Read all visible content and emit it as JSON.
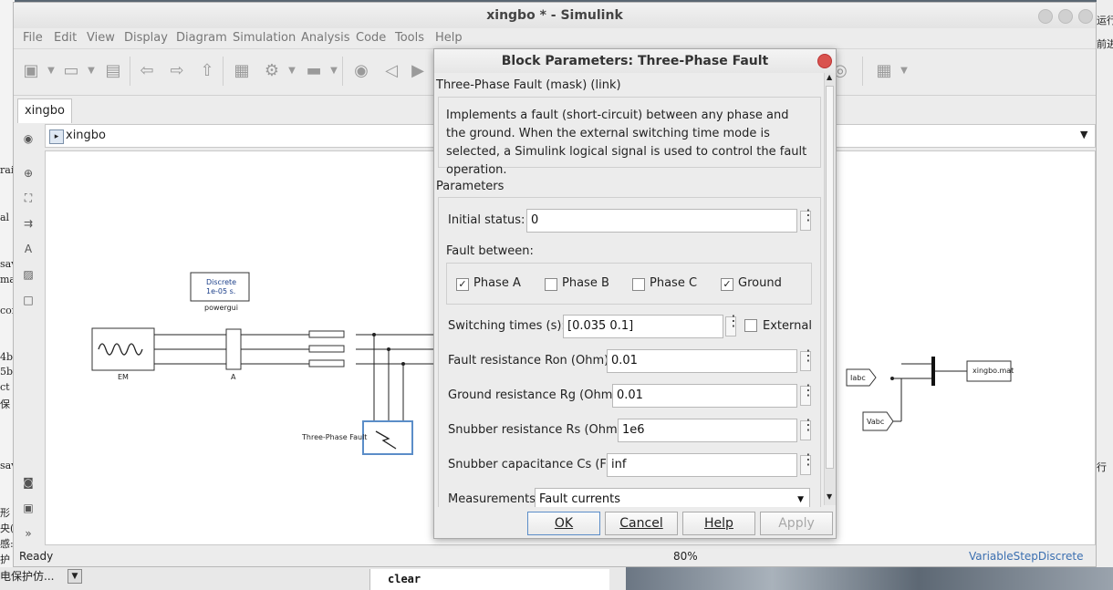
{
  "window": {
    "title": "xingbo * - Simulink"
  },
  "menu": [
    "File",
    "Edit",
    "View",
    "Display",
    "Diagram",
    "Simulation",
    "Analysis",
    "Code",
    "Tools",
    "Help"
  ],
  "tab": {
    "label": "xingbo"
  },
  "address": {
    "path": "xingbo"
  },
  "diagram": {
    "powergui": {
      "line1": "Discrete",
      "line2": "1e-05 s.",
      "caption": "powergui"
    },
    "em_label": "EM",
    "a_label": "A",
    "fault_label": "Three-Phase Fault",
    "iabc": "Iabc",
    "vabc": "Vabc",
    "tofile": "xingbo.mat"
  },
  "status": {
    "ready": "Ready",
    "zoom": "80%",
    "solver": "VariableStepDiscrete"
  },
  "dialog": {
    "title": "Block Parameters: Three-Phase Fault",
    "mask_label": "Three-Phase Fault (mask) (link)",
    "description": "Implements a fault (short-circuit) between any phase and the ground. When the external switching time mode is selected, a Simulink logical signal is used to control the fault operation.",
    "parameters_label": "Parameters",
    "initial_status": {
      "label": "Initial status:",
      "value": "0"
    },
    "fault_between_label": "Fault between:",
    "phase_a": {
      "label": "Phase A",
      "checked": true
    },
    "phase_b": {
      "label": "Phase B",
      "checked": false
    },
    "phase_c": {
      "label": "Phase C",
      "checked": false
    },
    "ground": {
      "label": "Ground",
      "checked": true
    },
    "switching_times": {
      "label": "Switching times (s):",
      "value": "[0.035  0.1]"
    },
    "external": {
      "label": "External",
      "checked": false
    },
    "ron": {
      "label": "Fault resistance Ron (Ohm):",
      "value": "0.01"
    },
    "rg": {
      "label": "Ground resistance Rg (Ohm):",
      "value": "0.01"
    },
    "rs": {
      "label": "Snubber resistance Rs (Ohm):",
      "value": "1e6"
    },
    "cs": {
      "label": "Snubber capacitance Cs (F):",
      "value": "inf"
    },
    "measurements": {
      "label": "Measurements",
      "value": "Fault currents"
    },
    "buttons": {
      "ok": "OK",
      "cancel": "Cancel",
      "help": "Help",
      "apply": "Apply"
    }
  },
  "background": {
    "left_fragments": [
      "rai",
      "al",
      "sav",
      "ma",
      "con",
      "4b",
      "5b",
      "ct",
      "保",
      "sav",
      "形",
      "央(",
      "感:",
      "护",
      "电保护仿..."
    ],
    "right_fragments": [
      "运行",
      "前进",
      "行"
    ],
    "command": "clear"
  }
}
